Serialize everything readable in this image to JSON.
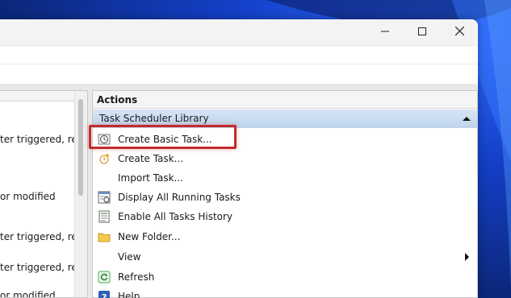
{
  "window": {
    "controls": {
      "minimize_icon": "minimize-icon",
      "maximize_icon": "maximize-icon",
      "close_icon": "close-icon"
    }
  },
  "left_pane": {
    "rows": [
      "ter triggered, rep",
      "or modified",
      "ter triggered, rep",
      "ter triggered, rep",
      "or modified"
    ]
  },
  "actions": {
    "header": "Actions",
    "section": "Task Scheduler Library",
    "items": [
      {
        "label": "Create Basic Task...",
        "icon": "create-basic-task-icon"
      },
      {
        "label": "Create Task...",
        "icon": "create-task-icon"
      },
      {
        "label": "Import Task...",
        "icon": ""
      },
      {
        "label": "Display All Running Tasks",
        "icon": "running-tasks-icon"
      },
      {
        "label": "Enable All Tasks History",
        "icon": "task-history-icon"
      },
      {
        "label": "New Folder...",
        "icon": "folder-icon"
      },
      {
        "label": "View",
        "icon": "",
        "has_submenu": true
      },
      {
        "label": "Refresh",
        "icon": "refresh-icon"
      },
      {
        "label": "Help",
        "icon": "help-icon"
      }
    ]
  },
  "colors": {
    "highlight": "#c42b2b",
    "section_header": "#c9dbef",
    "wallpaper": "#1440c8"
  }
}
